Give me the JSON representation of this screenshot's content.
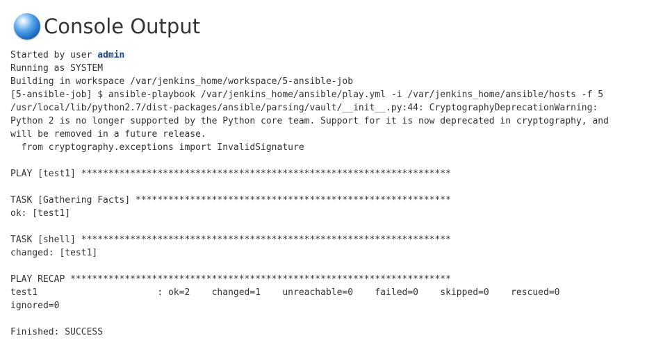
{
  "header": {
    "icon": "console-orb-icon",
    "title": "Console Output"
  },
  "console": {
    "started_prefix": "Started by user ",
    "user": "admin",
    "lines": [
      "Running as SYSTEM",
      "Building in workspace /var/jenkins_home/workspace/5-ansible-job",
      "[5-ansible-job] $ ansible-playbook /var/jenkins_home/ansible/play.yml -i /var/jenkins_home/ansible/hosts -f 5",
      "/usr/local/lib/python2.7/dist-packages/ansible/parsing/vault/__init__.py:44: CryptographyDeprecationWarning:",
      "Python 2 is no longer supported by the Python core team. Support for it is now deprecated in cryptography, and",
      "will be removed in a future release.",
      "  from cryptography.exceptions import InvalidSignature",
      "",
      "PLAY [test1] ********************************************************************",
      "",
      "TASK [Gathering Facts] **********************************************************",
      "ok: [test1]",
      "",
      "TASK [shell] ********************************************************************",
      "changed: [test1]",
      "",
      "PLAY RECAP **********************************************************************",
      "test1                      : ok=2    changed=1    unreachable=0    failed=0    skipped=0    rescued=0",
      "ignored=0",
      "",
      "Finished: SUCCESS"
    ]
  }
}
